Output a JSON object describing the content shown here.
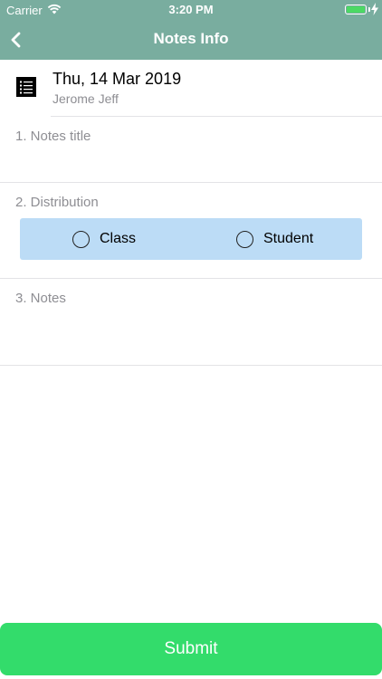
{
  "status_bar": {
    "carrier": "Carrier",
    "time": "3:20 PM",
    "icons": [
      "wifi-icon",
      "battery-icon",
      "charging-bolt-icon"
    ]
  },
  "nav": {
    "title": "Notes Info",
    "back_icon": "chevron-left-icon"
  },
  "header": {
    "icon": "list-icon",
    "date": "Thu, 14 Mar 2019",
    "author": "Jerome Jeff"
  },
  "form": {
    "notes_title": {
      "label": "1. Notes title",
      "value": "",
      "placeholder": ""
    },
    "distribution": {
      "label": "2. Distribution",
      "options": [
        {
          "label": "Class",
          "selected": false
        },
        {
          "label": "Student",
          "selected": false
        }
      ]
    },
    "notes": {
      "label": "3. Notes",
      "value": "",
      "placeholder": ""
    }
  },
  "submit": {
    "label": "Submit"
  },
  "colors": {
    "nav_bar": "#79ad9f",
    "distribution_bg": "#bcdcf6",
    "submit_bg": "#33dc6b",
    "battery": "#4cd964",
    "secondary_text": "#8e8e93"
  }
}
